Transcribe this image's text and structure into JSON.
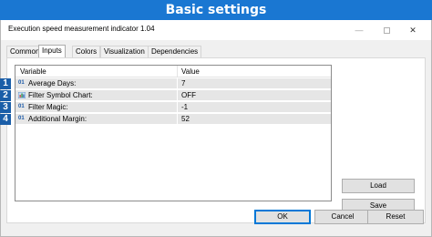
{
  "banner": {
    "title": "Basic settings"
  },
  "window": {
    "title": "Execution speed measurement indicator 1.04",
    "controls": {
      "minimize": "—",
      "close": "✕"
    }
  },
  "tabs": [
    {
      "label": "Common",
      "active": false
    },
    {
      "label": "Inputs",
      "active": true
    },
    {
      "label": "Colors",
      "active": false
    },
    {
      "label": "Visualization",
      "active": false
    },
    {
      "label": "Dependencies",
      "active": false
    }
  ],
  "grid": {
    "columns": {
      "variable": "Variable",
      "value": "Value"
    },
    "rows": [
      {
        "badge": "1",
        "type_icon": "01",
        "name": "Average Days:",
        "value": "7"
      },
      {
        "badge": "2",
        "type_icon": "chart-icon",
        "name": "Filter Symbol Chart:",
        "value": "OFF"
      },
      {
        "badge": "3",
        "type_icon": "01",
        "name": "Filter Magic:",
        "value": "-1"
      },
      {
        "badge": "4",
        "type_icon": "01",
        "name": "Additional Margin:",
        "value": "52"
      }
    ]
  },
  "side_buttons": {
    "load": "Load",
    "save": "Save"
  },
  "footer_buttons": {
    "ok": "OK",
    "cancel": "Cancel",
    "reset": "Reset"
  },
  "colors": {
    "banner": "#1a77d2",
    "badge": "#1a5ea8",
    "row_bg": "#e6e6e6",
    "default_button_border": "#0078d7"
  }
}
